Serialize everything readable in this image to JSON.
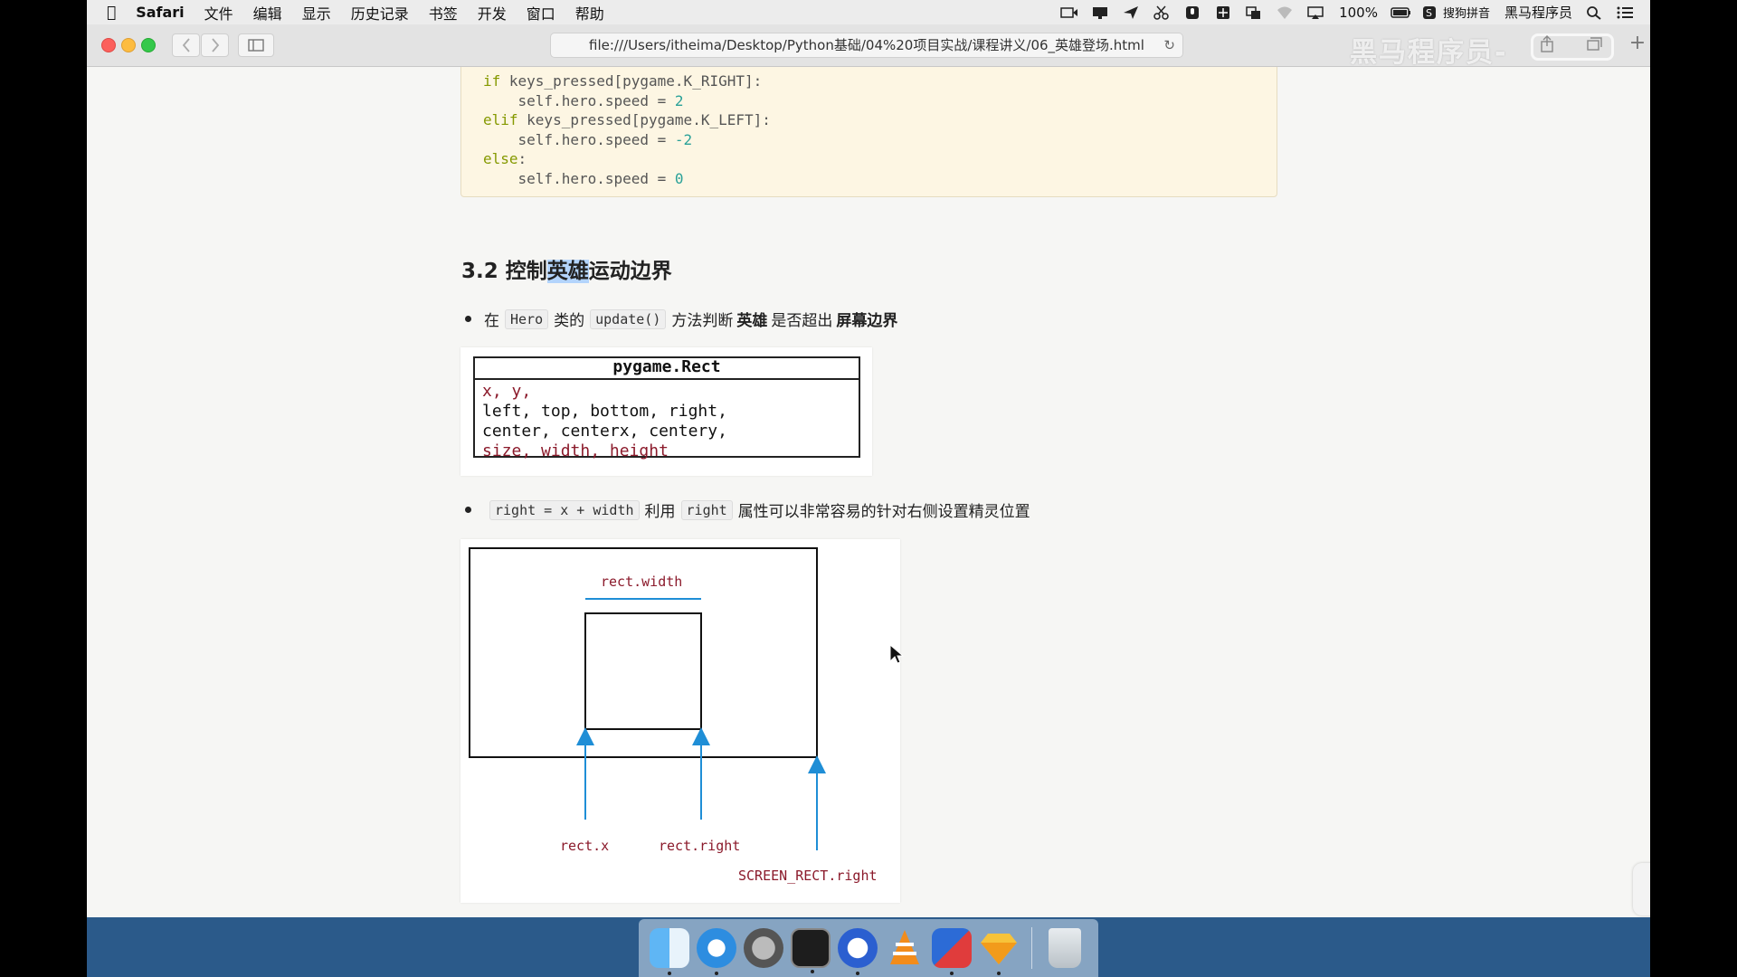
{
  "menubar": {
    "app": "Safari",
    "items": [
      "文件",
      "编辑",
      "显示",
      "历史记录",
      "书签",
      "开发",
      "窗口",
      "帮助"
    ],
    "battery": "100%",
    "input_method": "搜狗拼音",
    "user": "黑马程序员"
  },
  "toolbar": {
    "url": "file:///Users/itheima/Desktop/Python基础/04%20项目实战/课程讲义/06_英雄登场.html",
    "watermark": "黑马程序员-"
  },
  "code": {
    "lines": [
      {
        "kw": "if",
        "rest": " keys_pressed[pygame.K_RIGHT]:"
      },
      {
        "indent": "    ",
        "text": "self.hero.speed = ",
        "num": "2"
      },
      {
        "kw": "elif",
        "rest": " keys_pressed[pygame.K_LEFT]:"
      },
      {
        "indent": "    ",
        "text": "self.hero.speed = ",
        "num": "-2"
      },
      {
        "kw": "else",
        "rest": ":"
      },
      {
        "indent": "    ",
        "text": "self.hero.speed = ",
        "num": "0"
      }
    ]
  },
  "section": {
    "heading_pre": "3.2 控制",
    "heading_hl": "英雄",
    "heading_post": "运动边界"
  },
  "bullet1": {
    "t1": "在",
    "c1": "Hero",
    "t2": "类的",
    "c2": "update()",
    "t3": "方法判断",
    "b1": "英雄",
    "t4": "是否超出",
    "b2": "屏幕边界"
  },
  "rect_uml": {
    "title": "pygame.Rect",
    "row1": "x, y,",
    "row2": "left, top, bottom, right,",
    "row3": "center, centerx, centery,",
    "row4": "size, width, height"
  },
  "bullet2": {
    "c1": "right = x + width",
    "t1": "利用",
    "c2": "right",
    "t2": "属性可以非常容易的针对右侧设置精灵位置"
  },
  "figure": {
    "width_label": "rect.width",
    "x_label": "rect.x",
    "right_label": "rect.right",
    "screen_label": "SCREEN_RECT.right"
  },
  "colors": {
    "code_keyword": "#859900",
    "code_number": "#2aa198",
    "dark_red": "#8b1a2b",
    "arrow_blue": "#1f8ed6"
  }
}
